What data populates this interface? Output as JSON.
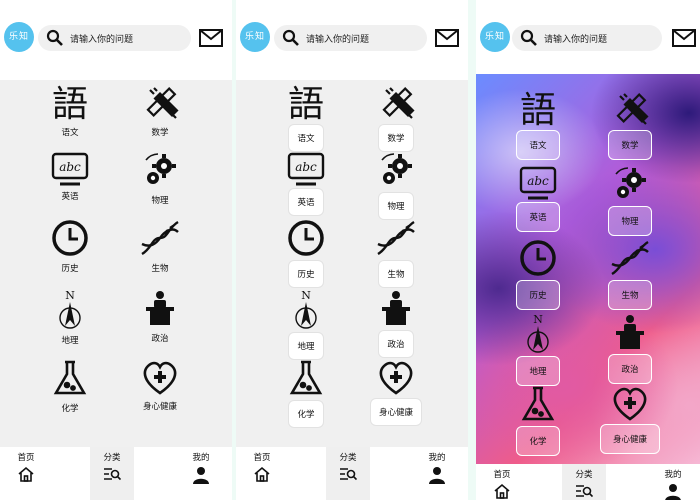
{
  "app": {
    "logo_text": "乐知",
    "search_placeholder": "请输入你的问题"
  },
  "subjects": [
    {
      "label": "语文",
      "icon": "chinese-char-icon"
    },
    {
      "label": "数学",
      "icon": "ruler-pencil-icon"
    },
    {
      "label": "英语",
      "icon": "abc-board-icon"
    },
    {
      "label": "物理",
      "icon": "gears-icon"
    },
    {
      "label": "历史",
      "icon": "clock-icon"
    },
    {
      "label": "生物",
      "icon": "dna-icon"
    },
    {
      "label": "地理",
      "icon": "compass-north-icon"
    },
    {
      "label": "政治",
      "icon": "podium-icon"
    },
    {
      "label": "化学",
      "icon": "flask-icon"
    },
    {
      "label": "身心健康",
      "icon": "heart-plus-icon"
    }
  ],
  "nav": {
    "home": "首页",
    "category": "分类",
    "mine": "我的"
  },
  "accent_logo": "#55c2ee",
  "variants": [
    "plain",
    "boxed",
    "glass"
  ]
}
